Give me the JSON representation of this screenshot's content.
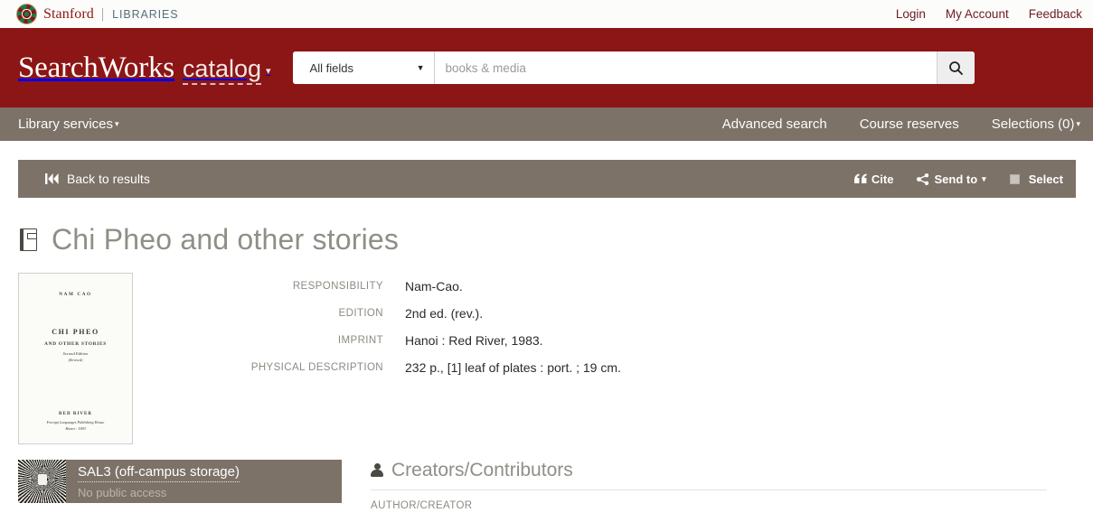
{
  "utility": {
    "brand": {
      "seal": "stanford-seal-icon",
      "stanford": "Stanford",
      "separator": "|",
      "libraries": "LIBRARIES"
    },
    "links": [
      {
        "label": "Login"
      },
      {
        "label": "My Account"
      },
      {
        "label": "Feedback"
      }
    ]
  },
  "masthead": {
    "logo_primary": "SearchWorks",
    "logo_secondary": "catalog",
    "logo_caret": "▾",
    "search": {
      "field_label": "All fields",
      "field_caret": "▼",
      "placeholder": "books & media",
      "value": "",
      "button_icon": "search-icon"
    }
  },
  "subnav": {
    "left": [
      {
        "label": "Library services",
        "caret": "▾"
      }
    ],
    "right": [
      {
        "label": "Advanced search"
      },
      {
        "label": "Course reserves"
      },
      {
        "label": "Selections (0)",
        "caret": "▾"
      }
    ]
  },
  "record_toolbar": {
    "back_label": "Back to results",
    "back_icon": "fast-backward-icon",
    "cite_label": "Cite",
    "cite_icon": "quote-left-icon",
    "send_to_label": "Send to",
    "send_to_icon": "share-alt-icon",
    "send_to_caret": "▾",
    "select_label": "Select",
    "select_icon": "checkbox-icon"
  },
  "record": {
    "title": "Chi Pheo and other stories",
    "title_icon": "book-icon",
    "cover": {
      "author": "NAM  CAO",
      "title": "CHI  PHEO",
      "subtitle": "AND OTHER STORIES",
      "edition": "Second Edition",
      "edition_note": "(Revised)",
      "publisher": "RED  RIVER",
      "publisher_line2": "Foreign Languages Publishing House",
      "publisher_line3": "Hanoi - 1983"
    },
    "metadata": [
      {
        "label": "RESPONSIBILITY",
        "value": "Nam-Cao."
      },
      {
        "label": "EDITION",
        "value": "2nd ed. (rev.)."
      },
      {
        "label": "IMPRINT",
        "value": "Hanoi : Red River, 1983."
      },
      {
        "label": "PHYSICAL DESCRIPTION",
        "value": "232 p., [1] leaf of plates : port. ; 19 cm."
      }
    ]
  },
  "location": {
    "thumb_icon": "library-stacks-photo",
    "name": "SAL3 (off-campus storage)",
    "status": "No public access"
  },
  "contributors": {
    "heading": "Creators/Contributors",
    "heading_icon": "person-icon",
    "first_label": "AUTHOR/CREATOR"
  },
  "colors": {
    "cardinal": "#8c1515",
    "taupe": "#7c7268",
    "title_gray": "#8f8f87",
    "label_gray": "#8b8b83"
  }
}
